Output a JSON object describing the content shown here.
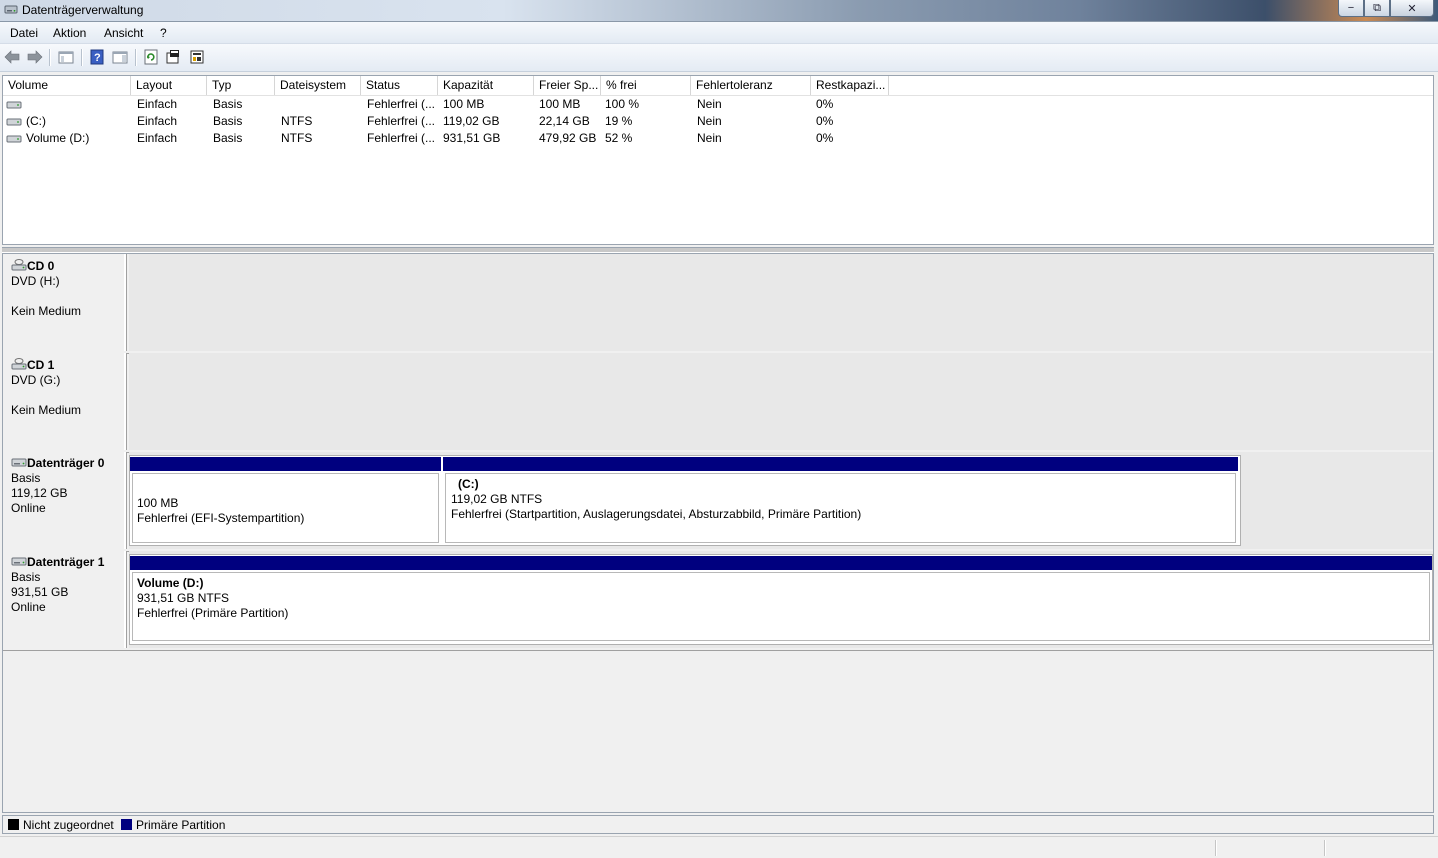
{
  "window": {
    "title": "Datenträgerverwaltung",
    "minimize": "−",
    "maximize": "⧉",
    "close": "✕"
  },
  "menu": {
    "items": [
      "Datei",
      "Aktion",
      "Ansicht",
      "?"
    ]
  },
  "toolbar": {
    "icons": [
      "back-icon",
      "forward-icon",
      "console-tree-icon",
      "help-icon",
      "show-hide-icon",
      "refresh-icon",
      "properties-icon",
      "settings-icon"
    ]
  },
  "volume_list": {
    "columns": [
      "Volume",
      "Layout",
      "Typ",
      "Dateisystem",
      "Status",
      "Kapazität",
      "Freier Sp...",
      "% frei",
      "Fehlertoleranz",
      "Restkapazi..."
    ],
    "rows": [
      [
        "",
        "Einfach",
        "Basis",
        "",
        "Fehlerfrei (...",
        "100 MB",
        "100 MB",
        "100 %",
        "Nein",
        "0%"
      ],
      [
        "(C:)",
        "Einfach",
        "Basis",
        "NTFS",
        "Fehlerfrei (...",
        "119,02 GB",
        "22,14 GB",
        "19 %",
        "Nein",
        "0%"
      ],
      [
        "Volume (D:)",
        "Einfach",
        "Basis",
        "NTFS",
        "Fehlerfrei (...",
        "931,51 GB",
        "479,92 GB",
        "52 %",
        "Nein",
        "0%"
      ]
    ]
  },
  "disks": [
    {
      "name": "CD 0",
      "line1": "DVD (H:)",
      "line2": "",
      "line3": "Kein Medium"
    },
    {
      "name": "CD 1",
      "line1": "DVD (G:)",
      "line2": "",
      "line3": "Kein Medium"
    },
    {
      "name": "Datenträger 0",
      "line1": "Basis",
      "line2": "119,12 GB",
      "line3": "Online"
    },
    {
      "name": "Datenträger 1",
      "line1": "Basis",
      "line2": "931,51 GB",
      "line3": "Online"
    }
  ],
  "partitions": {
    "disk0_p1": {
      "title": "",
      "size": "100 MB",
      "status": "Fehlerfrei (EFI-Systempartition)"
    },
    "disk0_p2": {
      "title": "(C:)",
      "size": "119,02 GB NTFS",
      "status": "Fehlerfrei (Startpartition, Auslagerungsdatei, Absturzabbild, Primäre Partition)"
    },
    "disk1_p1": {
      "title": "Volume  (D:)",
      "size": "931,51 GB NTFS",
      "status": "Fehlerfrei (Primäre Partition)"
    }
  },
  "legend": {
    "unallocated": "Nicht zugeordnet",
    "unallocated_color": "#000000",
    "primary": "Primäre Partition",
    "primary_color": "#00007f"
  }
}
